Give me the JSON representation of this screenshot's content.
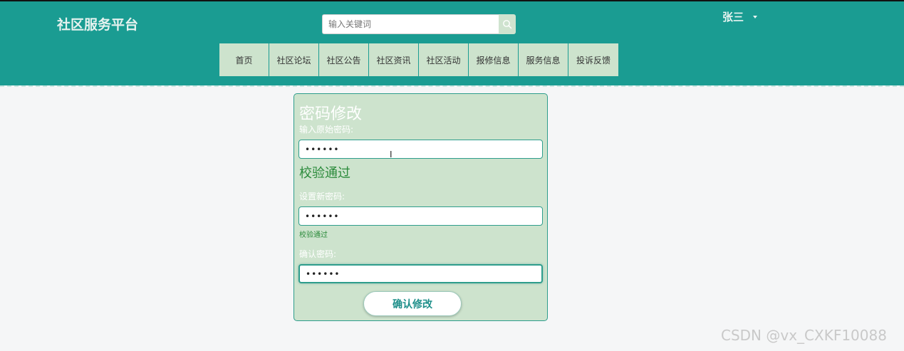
{
  "header": {
    "brand": "社区服务平台",
    "search": {
      "placeholder": "输入关键词",
      "value": ""
    },
    "user": {
      "name": "张三"
    }
  },
  "nav": {
    "items": [
      {
        "label": "首页"
      },
      {
        "label": "社区论坛"
      },
      {
        "label": "社区公告"
      },
      {
        "label": "社区资讯"
      },
      {
        "label": "社区活动"
      },
      {
        "label": "报修信息"
      },
      {
        "label": "服务信息"
      },
      {
        "label": "投诉反馈"
      }
    ]
  },
  "form": {
    "title": "密码修改",
    "old_password": {
      "label": "输入原始密码:",
      "value": "••••••"
    },
    "old_status": "校验通过",
    "new_password": {
      "label": "设置新密码:",
      "value": "••••••"
    },
    "new_status": "校验通过",
    "confirm_password": {
      "label": "确认密码:",
      "value": "••••••"
    },
    "submit_label": "确认修改"
  },
  "watermark": "CSDN @vx_CXKF10088",
  "colors": {
    "header_bg": "#1a9c92",
    "nav_bg": "#cde3cd",
    "card_bg": "#cde3cd",
    "accent": "#2e9d8c",
    "success": "#2a8a3a"
  },
  "icons": {
    "search": "search-icon",
    "dropdown": "caret-down-icon"
  }
}
